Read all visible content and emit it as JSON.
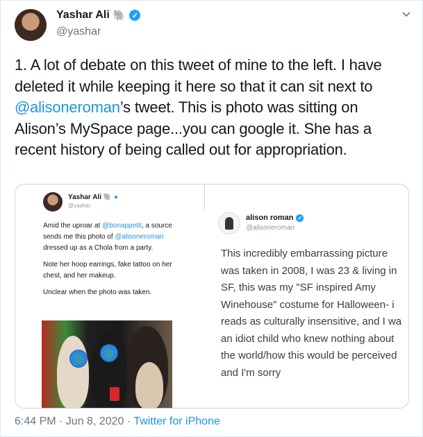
{
  "tweet": {
    "display_name": "Yashar Ali",
    "name_emoji": "🐘",
    "handle": "@yashar",
    "text_before_mention": "1. A lot of debate on this tweet of mine to the left. I have deleted it while keeping it here so that it can sit next to ",
    "mention": "@alisoneroman",
    "text_after_mention": "’s tweet. This is photo was sitting on Alison’s MySpace page...you can google it. She has a recent history of being called out for appropriation.",
    "timestamp": "6:44 PM · Jun 8, 2020 · ",
    "source": "Twitter for iPhone"
  },
  "embedded_left": {
    "display_name": "Yashar Ali",
    "name_emoji": "🐘",
    "handle": "@yashar",
    "para1_a": "Amid the uproar at ",
    "para1_mention1": "@bonappetit",
    "para1_b": ", a source sends me this photo of ",
    "para1_mention2": "@alisoneroman",
    "para1_c": " dressed up as a Chola from a party.",
    "para2": "Note her hoop earrings, fake tattoo on her chest, and her makeup.",
    "para3": "Unclear when the photo was taken."
  },
  "embedded_right": {
    "display_name": "alison roman",
    "handle": "@alisoneroman",
    "text": "This incredibly embarrassing picture\nwas taken in 2008, I was 23 & living in\nSF, this was my \"SF inspired Amy\nWinehouse\" costume for Halloween- i\nreads as culturally insensitive, and I wa\nan idiot child who knew nothing about\nthe world/how this would be perceived\nand I'm sorry"
  },
  "icons": {
    "verified": "verified-badge-icon",
    "chevron": "chevron-down-icon",
    "globe": "globe-emoji-icon"
  },
  "colors": {
    "link": "#1b95e0",
    "verified": "#1da1f2",
    "muted": "#657786"
  }
}
